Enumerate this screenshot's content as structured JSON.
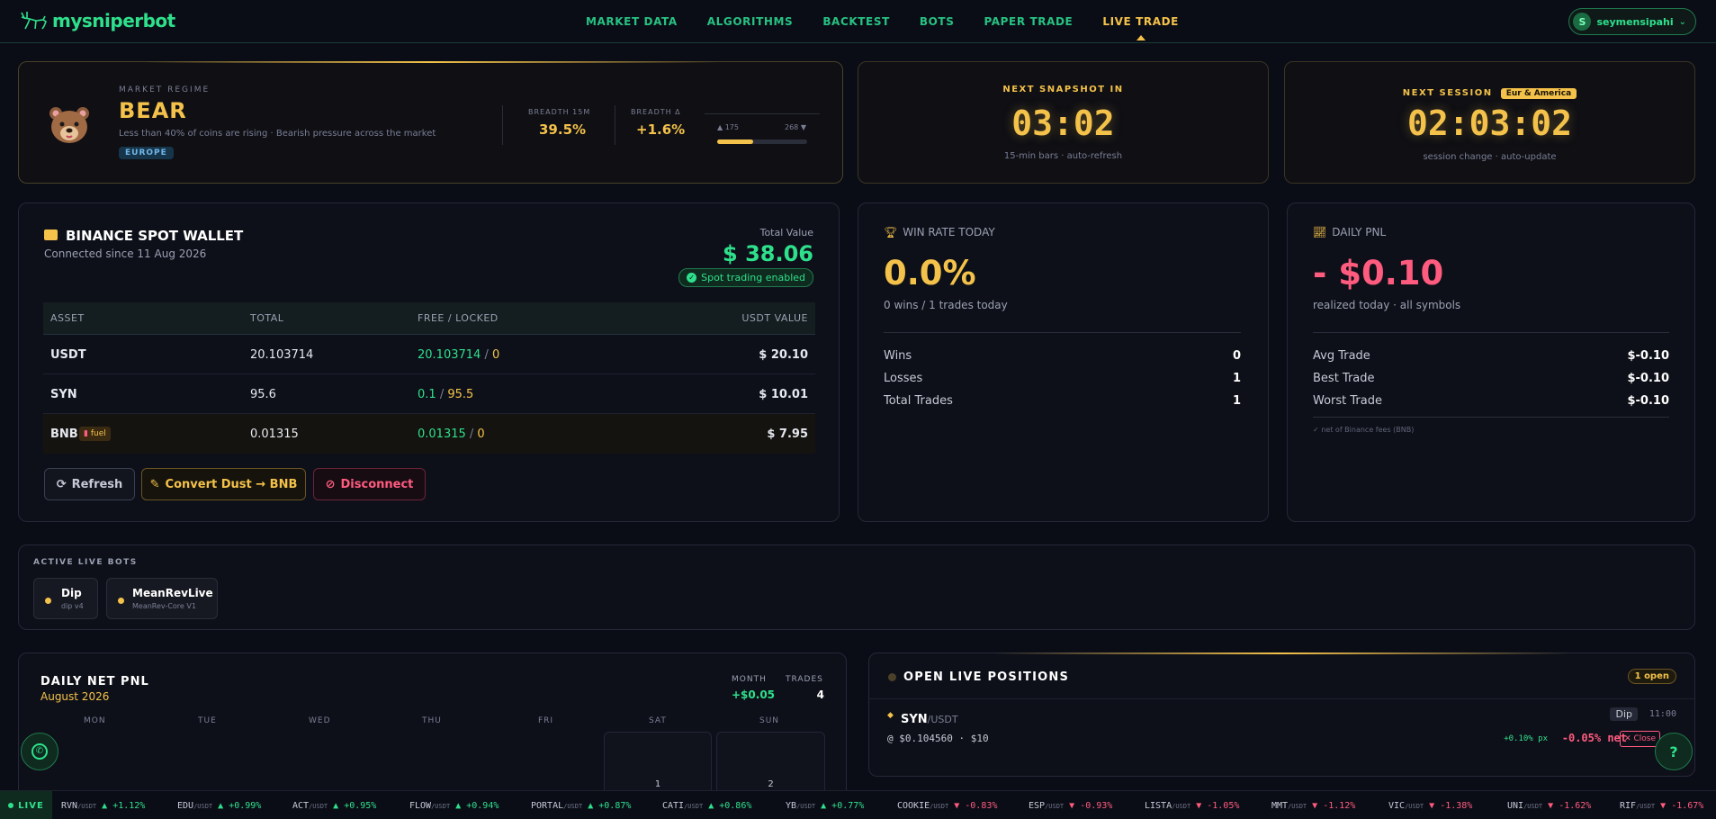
{
  "brand": {
    "name": "mysniperbot",
    "user_initial": "S",
    "user_name": "seymensipahi",
    "accent": "#2ee08c",
    "gold": "#f4c24a",
    "red": "#ff5b7f"
  },
  "nav": [
    "MARKET DATA",
    "ALGORITHMS",
    "BACKTEST",
    "BOTS",
    "PAPER TRADE",
    "LIVE TRADE"
  ],
  "nav_active": "LIVE TRADE",
  "regime": {
    "label": "MARKET REGIME",
    "value": "BEAR",
    "desc": "Less than 40% of coins are rising · Bearish pressure across the market",
    "region": "EUROPE",
    "breadth_label": "BREADTH 15M",
    "breadth": "39.5%",
    "delta_label": "BREADTH Δ",
    "delta": "+1.6%",
    "up": "▲ 175",
    "down": "268 ▼",
    "up_fraction": 0.395
  },
  "snapshot": {
    "label": "NEXT SNAPSHOT IN",
    "time": "03:02",
    "sub": "15-min bars · auto-refresh"
  },
  "session": {
    "label": "NEXT SESSION",
    "badge": "Eur & America",
    "time": "02:03:02",
    "sub": "session change · auto-update"
  },
  "wallet": {
    "title": "BINANCE SPOT WALLET",
    "since": "Connected since 11 Aug 2026",
    "total_label": "Total Value",
    "total": "$ 38.06",
    "status": "Spot trading enabled",
    "headers": [
      "ASSET",
      "TOTAL",
      "FREE / LOCKED",
      "USDT VALUE"
    ],
    "rows": [
      {
        "asset": "USDT",
        "total": "20.103714",
        "free": "20.103714",
        "sep": " / ",
        "locked": "0",
        "value": "$ 20.10"
      },
      {
        "asset": "SYN",
        "total": "95.6",
        "free": "0.1",
        "sep": " / ",
        "locked": "95.5",
        "value": "$ 10.01"
      },
      {
        "asset": "BNB",
        "fuel": "fuel",
        "total": "0.01315",
        "free": "0.01315",
        "sep": " / ",
        "locked": "0",
        "value": "$ 7.95"
      }
    ],
    "refresh": "Refresh",
    "convert": "Convert Dust → BNB",
    "disconnect": "Disconnect"
  },
  "winrate": {
    "title": "WIN RATE TODAY",
    "value": "0.0%",
    "sub": "0 wins / 1 trades today",
    "stats": [
      {
        "label": "Wins",
        "value": "0"
      },
      {
        "label": "Losses",
        "value": "1"
      },
      {
        "label": "Total Trades",
        "value": "1"
      }
    ]
  },
  "pnl": {
    "title": "DAILY PNL",
    "value": "- $0.10",
    "sub": "realized today · all symbols",
    "stats": [
      {
        "label": "Avg Trade",
        "value": "$-0.10"
      },
      {
        "label": "Best Trade",
        "value": "$-0.10"
      },
      {
        "label": "Worst Trade",
        "value": "$-0.10"
      }
    ],
    "note": "✓ net of Binance fees (BNB)"
  },
  "bots": {
    "label": "ACTIVE LIVE BOTS",
    "items": [
      {
        "name": "Dip",
        "sub": "dip v4"
      },
      {
        "name": "MeanRevLive",
        "sub": "MeanRev-Core V1"
      }
    ]
  },
  "calendar": {
    "title": "DAILY NET PNL",
    "month": "August 2026",
    "month_label": "MONTH",
    "month_value": "+$0.05",
    "trades_label": "TRADES",
    "trades_value": "4",
    "days": [
      "MON",
      "TUE",
      "WED",
      "THU",
      "FRI",
      "SAT",
      "SUN"
    ],
    "dates": [
      "1",
      "2"
    ]
  },
  "positions": {
    "title": "OPEN LIVE POSITIONS",
    "count": "1 open",
    "sym": "SYN",
    "quote": "/USDT",
    "bot": "Dip",
    "time": "11:00",
    "detail": "@ $0.104560 · $10",
    "px": "+0.10% px",
    "net": "-0.05% net",
    "close": "✕ Close"
  },
  "ticker": {
    "live": "LIVE",
    "items": [
      {
        "s": "RVN",
        "q": "/USDT",
        "c": "▲ +1.12%",
        "up": true
      },
      {
        "s": "EDU",
        "q": "/USDT",
        "c": "▲ +0.99%",
        "up": true
      },
      {
        "s": "ACT",
        "q": "/USDT",
        "c": "▲ +0.95%",
        "up": true
      },
      {
        "s": "FLOW",
        "q": "/USDT",
        "c": "▲ +0.94%",
        "up": true
      },
      {
        "s": "PORTAL",
        "q": "/USDT",
        "c": "▲ +0.87%",
        "up": true
      },
      {
        "s": "CATI",
        "q": "/USDT",
        "c": "▲ +0.86%",
        "up": true
      },
      {
        "s": "YB",
        "q": "/USDT",
        "c": "▲ +0.77%",
        "up": true
      },
      {
        "s": "COOKIE",
        "q": "/USDT",
        "c": "▼ -0.83%",
        "up": false
      },
      {
        "s": "ESP",
        "q": "/USDT",
        "c": "▼ -0.93%",
        "up": false
      },
      {
        "s": "LISTA",
        "q": "/USDT",
        "c": "▼ -1.05%",
        "up": false
      },
      {
        "s": "MMT",
        "q": "/USDT",
        "c": "▼ -1.12%",
        "up": false
      },
      {
        "s": "VIC",
        "q": "/USDT",
        "c": "▼ -1.38%",
        "up": false
      },
      {
        "s": "UNI",
        "q": "/USDT",
        "c": "▼ -1.62%",
        "up": false
      },
      {
        "s": "RIF",
        "q": "/USDT",
        "c": "▼ -1.67%",
        "up": false
      }
    ]
  }
}
